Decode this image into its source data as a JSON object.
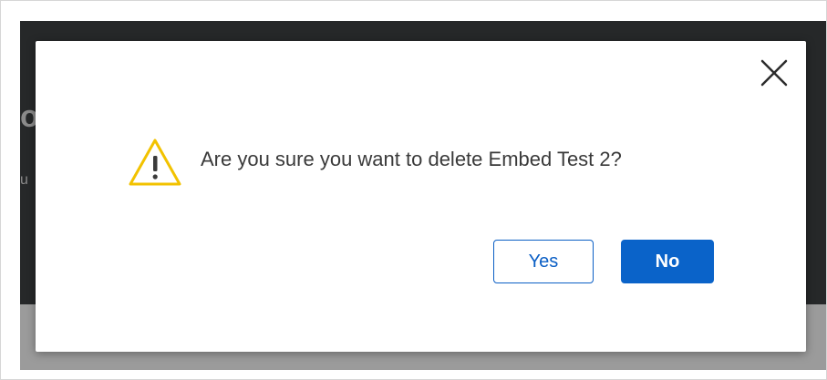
{
  "background": {
    "peek_heading_fragment": "o",
    "peek_text_fragment": "u"
  },
  "dialog": {
    "message": "Are you sure you want to delete Embed Test 2?",
    "icon": "warning-icon",
    "close_icon": "close-icon",
    "yes_label": "Yes",
    "no_label": "No"
  },
  "colors": {
    "primary": "#0a63c9",
    "warning": "#f2c200",
    "overlay_dark": "#262829",
    "overlay_gray": "#9b9b9b"
  }
}
